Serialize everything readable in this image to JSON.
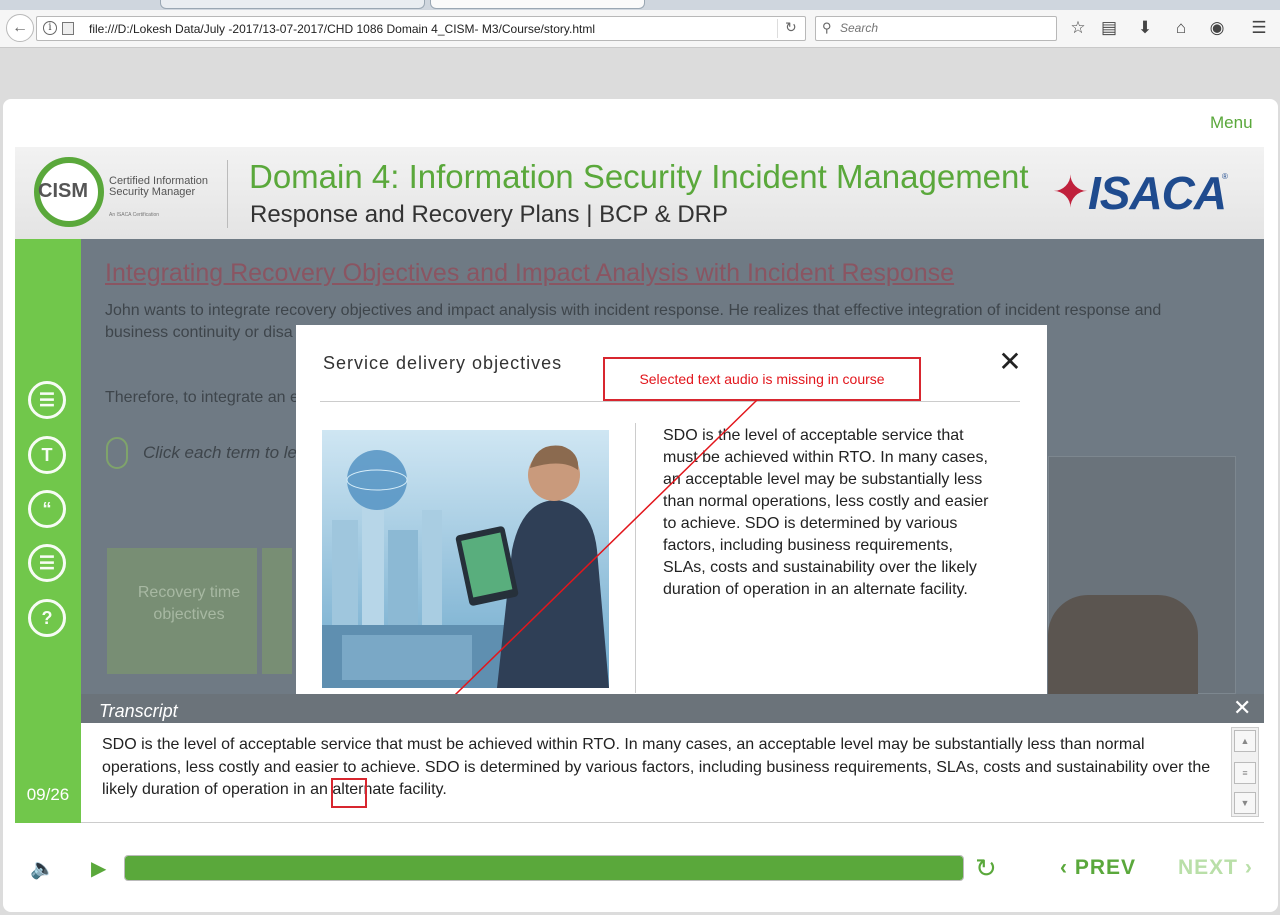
{
  "browser": {
    "url": "file:///D:/Lokesh Data/July -2017/13-07-2017/CHD 1086 Domain 4_CISM- M3/Course/story.html",
    "search_placeholder": "Search"
  },
  "header": {
    "cism_logo_text": "CISM",
    "cism_logo_subtitle": "Certified Information Security Manager",
    "cism_logo_tagline": "An ISACA Certification",
    "domain_title": "Domain 4: Information Security Incident Management",
    "domain_subtitle": "Response and Recovery Plans | BCP & DRP",
    "isaca_logo_text": "ISACA",
    "menu_label": "Menu"
  },
  "slide": {
    "title": "Integrating Recovery Objectives and Impact Analysis with Incident Response",
    "paragraph": "John wants to integrate recovery objectives and impact analysis with incident response. He realizes that effective integration of incident response and business continuity or disa                                                                                                     jective (RPO), service delivery objective (SDO) an",
    "paragraph2": "Therefore, to integrate an e",
    "instruction": "Click each term to lea",
    "card_label": "Recovery time objectives",
    "counter": "09/26"
  },
  "popup": {
    "title": "Service delivery objectives",
    "body": "SDO is the level of acceptable service that must be achieved within RTO. In many cases, an acceptable level may be substantially less than normal operations, less costly and easier to achieve. SDO is determined by various factors, including business requirements, SLAs, costs and sustainability over the likely duration of operation in an alternate facility."
  },
  "callout": {
    "text": "Selected text audio is missing in course"
  },
  "transcript": {
    "title": "Transcript",
    "text": "SDO is the level of acceptable service that must be achieved within RTO. In many cases, an acceptable level may be substantially less than normal operations, less costly and easier to achieve. SDO is determined by various factors, including business requirements, SLAs, costs and sustainability over the likely duration of operation in an alternate facility."
  },
  "controls": {
    "prev_label": "PREV",
    "next_label": "NEXT",
    "progress": 1.0
  },
  "colors": {
    "accent": "#5aa83b",
    "annotation": "#d8262f"
  }
}
